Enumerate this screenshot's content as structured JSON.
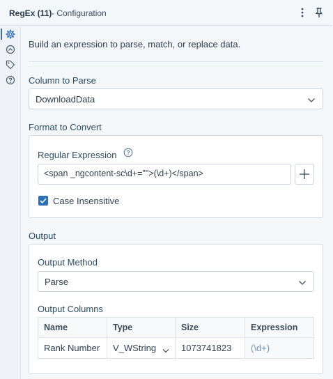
{
  "header": {
    "title": "RegEx (11)",
    "subtitle": "- Configuration",
    "icons": [
      "more-vertical-icon",
      "pin-icon"
    ]
  },
  "rail": {
    "items": [
      "gear-icon",
      "refresh-arrow-icon",
      "tag-icon",
      "question-icon"
    ],
    "active": "gear-icon"
  },
  "description": "Build an expression to parse, match, or replace data.",
  "column_to_parse": {
    "label": "Column to Parse",
    "value": "DownloadData"
  },
  "format_to_convert": {
    "label": "Format to Convert",
    "regex_label": "Regular Expression",
    "regex_value": "<span _ngcontent-sc\\d+=\"\">(\\d+)</span>",
    "case_insensitive_label": "Case Insensitive",
    "case_insensitive_checked": true
  },
  "output": {
    "label": "Output",
    "method_label": "Output Method",
    "method_value": "Parse",
    "columns_label": "Output Columns",
    "table": {
      "headers": [
        "Name",
        "Type",
        "Size",
        "Expression"
      ],
      "rows": [
        {
          "name": "Rank Number",
          "type": "V_WString",
          "size": "1073741823",
          "expression": "(\\d+)"
        }
      ]
    }
  },
  "colors": {
    "accent": "#2c6fb6",
    "label_blue": "#2b4c66",
    "expression_text": "#6b95c2",
    "background": "#f4f7fa"
  }
}
